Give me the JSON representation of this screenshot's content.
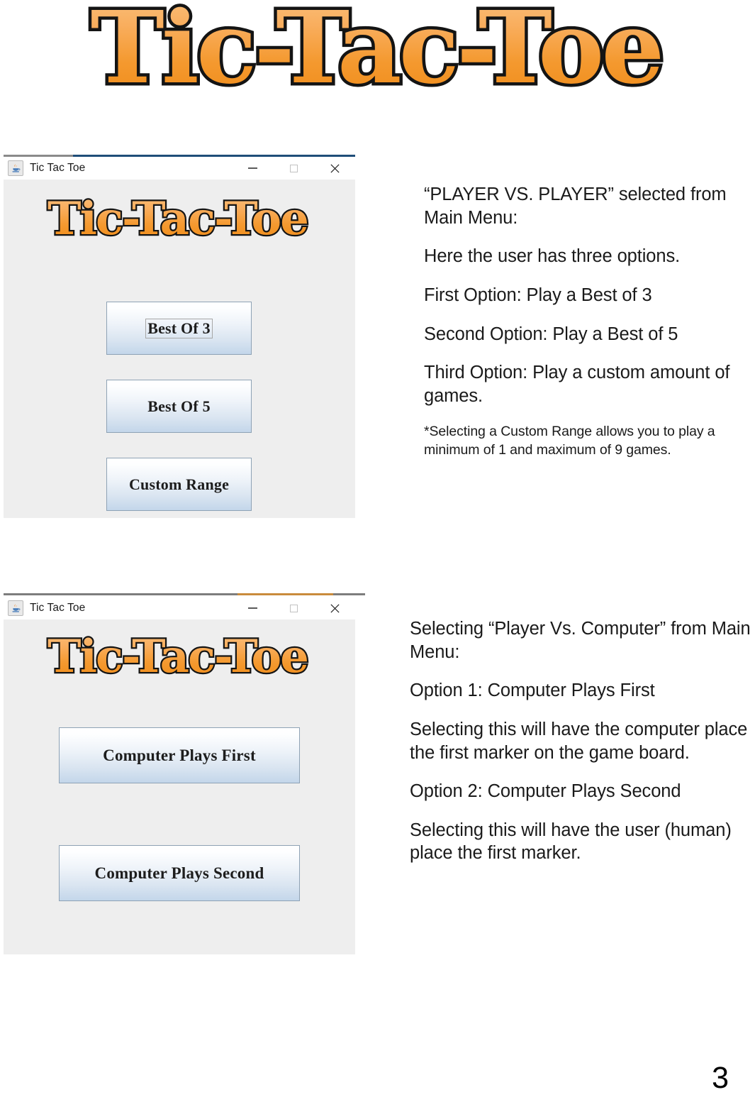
{
  "document": {
    "page_number": "3",
    "title_logo_text": "Tic-Tac-Toe"
  },
  "windows": [
    {
      "id": "player-vs-player-window",
      "title": "Tic Tac Toe",
      "icon": "java-coffee-cup-icon",
      "logo_text": "Tic-Tac-Toe",
      "controls": {
        "minimize": "minimize-icon",
        "maximize": "maximize-icon",
        "close": "close-icon"
      },
      "buttons": [
        {
          "label": "Best Of 3",
          "focused": true
        },
        {
          "label": "Best Of 5",
          "focused": false
        },
        {
          "label": "Custom Range",
          "focused": false
        }
      ]
    },
    {
      "id": "player-vs-computer-window",
      "title": "Tic Tac Toe",
      "icon": "java-coffee-cup-icon",
      "logo_text": "Tic-Tac-Toe",
      "controls": {
        "minimize": "minimize-icon",
        "maximize": "maximize-icon",
        "close": "close-icon"
      },
      "buttons": [
        {
          "label": "Computer Plays First",
          "focused": false
        },
        {
          "label": "Computer Plays Second",
          "focused": false
        }
      ]
    }
  ],
  "notes": {
    "player_vs_player": {
      "p1": "“PLAYER VS. PLAYER” selected from Main Menu:",
      "p2": "Here the user has three options.",
      "p3": "First Option: Play a Best of 3",
      "p4": "Second Option: Play a Best of 5",
      "p5": "Third Option: Play a custom amount of games.",
      "p6": "*Selecting a Custom Range allows you to play a minimum of 1 and maximum of 9 games."
    },
    "player_vs_computer": {
      "p1": "Selecting “Player Vs. Computer” from Main Menu:",
      "p2": "Option 1: Computer Plays First",
      "p3": "Selecting this will have the computer place the first marker on the game board.",
      "p4": "Option 2: Computer Plays Second",
      "p5": "Selecting this will have the user (human) place the first marker."
    }
  },
  "colors": {
    "logo_orange_light": "#f8b06a",
    "logo_orange_dark": "#f08c2e",
    "logo_outline": "#1a1a1a",
    "window_client_bg": "#eeeeee",
    "titlebar_accent": "#1f4e79",
    "button_border": "#8ea2b5"
  }
}
